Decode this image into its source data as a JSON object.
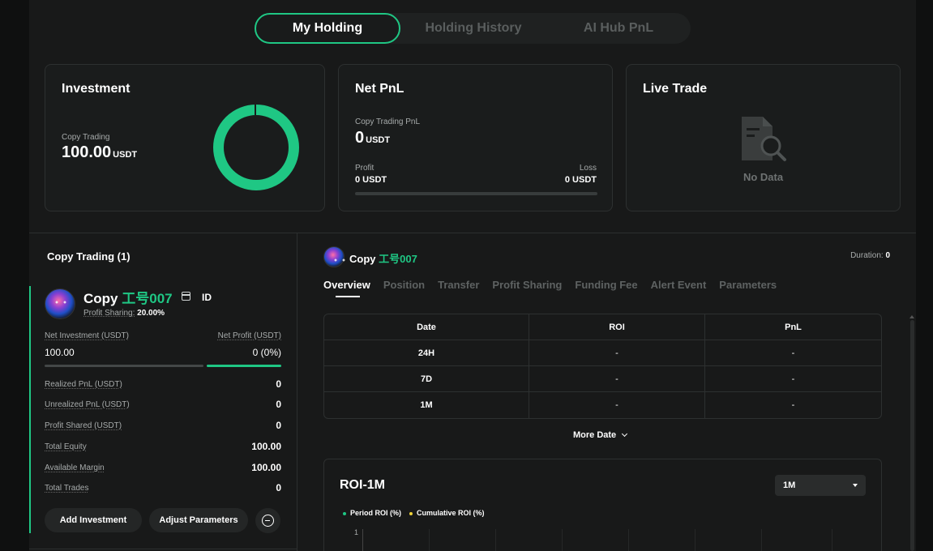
{
  "tabs": [
    {
      "label": "My Holding",
      "active": true
    },
    {
      "label": "Holding History",
      "active": false
    },
    {
      "label": "AI Hub PnL",
      "active": false
    }
  ],
  "investment": {
    "title": "Investment",
    "label": "Copy Trading",
    "value": "100.00",
    "unit": "USDT"
  },
  "net_pnl": {
    "title": "Net PnL",
    "label": "Copy Trading PnL",
    "value": "0",
    "unit": "USDT",
    "profit_label": "Profit",
    "profit_value": "0 USDT",
    "loss_label": "Loss",
    "loss_value": "0 USDT"
  },
  "live_trade": {
    "title": "Live Trade",
    "empty_text": "No Data"
  },
  "left_panel": {
    "title": "Copy Trading (1)",
    "trader": {
      "prefix": "Copy ",
      "name": "工号007",
      "id_label": "ID",
      "profit_sharing_label": "Profit Sharing:",
      "profit_sharing_value": "20.00%"
    },
    "net_investment_label": "Net Investment (USDT)",
    "net_investment_value": "100.00",
    "net_profit_label": "Net Profit (USDT)",
    "net_profit_value": "0 (0%)",
    "stats": [
      {
        "label": "Realized PnL (USDT)",
        "value": "0"
      },
      {
        "label": "Unrealized PnL (USDT)",
        "value": "0"
      },
      {
        "label": "Profit Shared (USDT)",
        "value": "0"
      },
      {
        "label": "Total Equity",
        "value": "100.00"
      },
      {
        "label": "Available Margin",
        "value": "100.00"
      },
      {
        "label": "Total Trades",
        "value": "0"
      }
    ],
    "add_investment": "Add Investment",
    "adjust_parameters": "Adjust Parameters"
  },
  "right_panel": {
    "trader_prefix": "Copy ",
    "trader_name": "工号007",
    "duration_label": "Duration:",
    "duration_value": "0",
    "subtabs": [
      "Overview",
      "Position",
      "Transfer",
      "Profit Sharing",
      "Funding Fee",
      "Alert Event",
      "Parameters"
    ],
    "table": {
      "headers": [
        "Date",
        "ROI",
        "PnL"
      ],
      "rows": [
        [
          "24H",
          "-",
          "-"
        ],
        [
          "7D",
          "-",
          "-"
        ],
        [
          "1M",
          "-",
          "-"
        ]
      ]
    },
    "more_date": "More Date",
    "roi_chart": {
      "title": "ROI-1M",
      "range_select": "1M",
      "legend": [
        {
          "name": "Period ROI (%)",
          "color": "#1fc784"
        },
        {
          "name": "Cumulative ROI (%)",
          "color": "#f0d43a"
        }
      ],
      "y_tick_top": "1"
    }
  },
  "colors": {
    "accent": "#1fc784",
    "background": "#181919",
    "card": "#1a1c1c"
  }
}
